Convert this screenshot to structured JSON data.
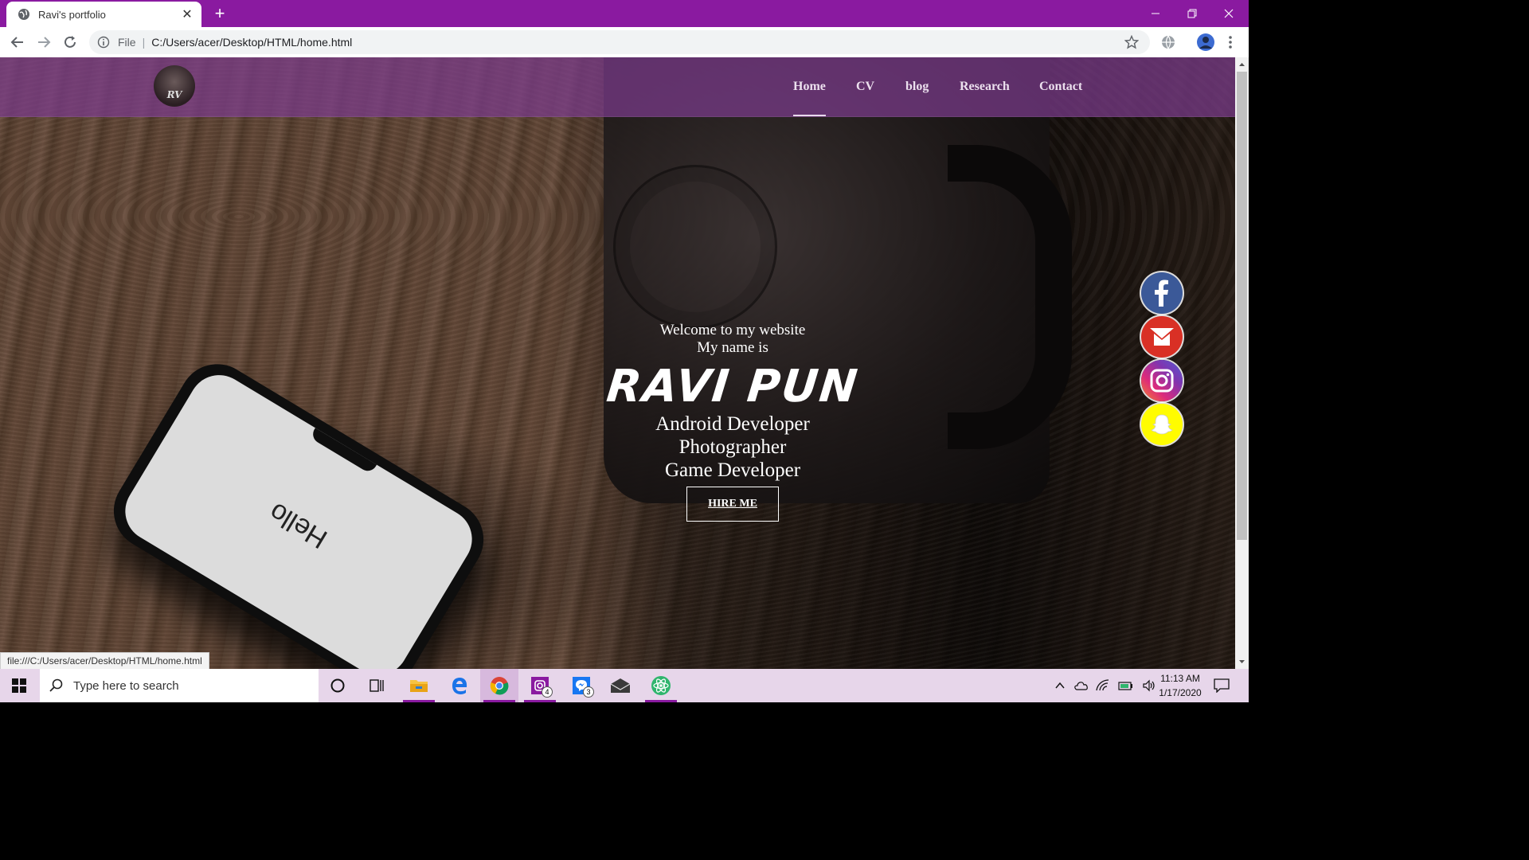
{
  "browser": {
    "tab_title": "Ravi's portfolio",
    "new_tab_symbol": "+",
    "url_scheme_label": "File",
    "url": "C:/Users/acer/Desktop/HTML/home.html",
    "status_bar_url": "file:///C:/Users/acer/Desktop/HTML/home.html",
    "accent_color": "#8a1aa0"
  },
  "site": {
    "logo_text": "RV",
    "nav": [
      {
        "label": "Home",
        "active": true
      },
      {
        "label": "CV",
        "active": false
      },
      {
        "label": "blog",
        "active": false
      },
      {
        "label": "Research",
        "active": false
      },
      {
        "label": "Contact",
        "active": false
      }
    ],
    "hero": {
      "welcome": "Welcome to my website",
      "intro": "My name is",
      "name": "RAVI PUN",
      "roles": [
        "Android Developer",
        "Photographer",
        "Game Developer"
      ],
      "cta": "HIRE ME"
    },
    "photo_text": "Hello",
    "social": [
      {
        "icon": "facebook-icon",
        "color": "#3b5998"
      },
      {
        "icon": "gmail-icon",
        "color": "#d93025"
      },
      {
        "icon": "instagram-icon",
        "color": "#c13584"
      },
      {
        "icon": "snapchat-icon",
        "color": "#fffc00"
      }
    ]
  },
  "taskbar": {
    "search_placeholder": "Type here to search",
    "apps": [
      {
        "icon": "cortana-icon"
      },
      {
        "icon": "task-view-icon"
      },
      {
        "icon": "file-explorer-icon"
      },
      {
        "icon": "edge-icon"
      },
      {
        "icon": "chrome-icon"
      },
      {
        "icon": "instagram-app-icon",
        "badge": "4"
      },
      {
        "icon": "messenger-icon",
        "badge": "3"
      },
      {
        "icon": "mail-icon"
      },
      {
        "icon": "atom-icon"
      }
    ],
    "time": "11:13 AM",
    "date": "1/17/2020"
  }
}
